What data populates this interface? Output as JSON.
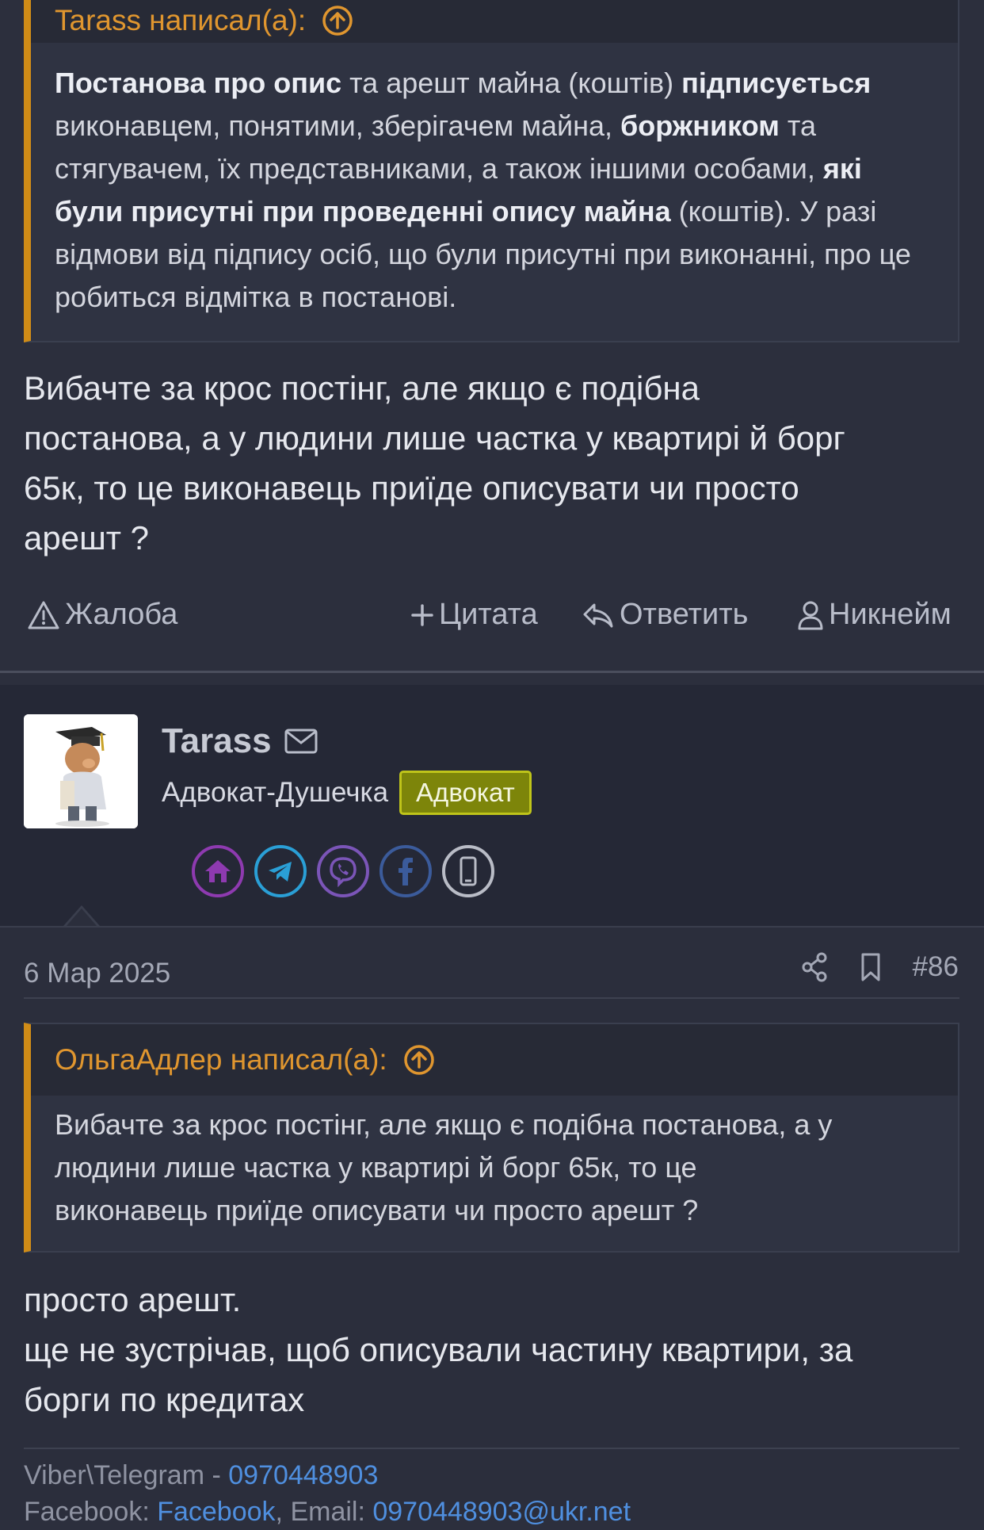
{
  "post1": {
    "quote": {
      "author_line": "Tarass написал(а):",
      "bold1": "Постанова про опис",
      "text1": " та арешт майна (коштів) ",
      "bold2": "підписується",
      "text2": " виконавцем, понятими, зберігачем майна, ",
      "bold3": "боржником",
      "text3": " та стягувачем, їх представниками, а також іншими особами, ",
      "bold4": "які були присутні при проведенні опису майна",
      "text4": " (коштів). У разі відмови від підпису осіб, що були присутні при виконанні, про це робиться відмітка в постанові."
    },
    "message_lines": [
      "Вибачте за крос постінг, але якщо є подібна",
      "постанова, а у людини лише частка у квартирі й борг",
      "65к, то це виконавець приїде описувати чи просто",
      "арешт ?"
    ],
    "actions": {
      "report": "Жалоба",
      "quote": "Цитата",
      "reply": "Ответить",
      "nickname": "Никнейм"
    }
  },
  "post2": {
    "user": {
      "name": "Tarass",
      "title": "Адвокат-Душечка",
      "badge": "Адвокат"
    },
    "socials": [
      {
        "icon": "home-icon",
        "color": "#8e3ab0"
      },
      {
        "icon": "telegram-icon",
        "color": "#2a9fd6"
      },
      {
        "icon": "viber-icon",
        "color": "#7b55b8"
      },
      {
        "icon": "facebook-icon",
        "color": "#3b5b9b"
      },
      {
        "icon": "phone-icon",
        "color": "#b9bcc6"
      }
    ],
    "date": "6 Мар 2025",
    "post_number": "#86",
    "quote": {
      "author_line": "ОльгаАдлер написал(а):",
      "lines": [
        "Вибачте за крос постінг, але якщо є подібна постанова, а у",
        "людини лише частка у квартирі й борг 65к, то це",
        "виконавець приїде описувати чи просто арешт ?"
      ]
    },
    "message_lines": [
      "просто арешт.",
      "ще не зустрічав, щоб описували частину квартири, за",
      "борги по кредитах"
    ],
    "signature": {
      "line1_label": "Viber\\Telegram - ",
      "line1_phone": "0970448903",
      "line2_label": "Facebook: ",
      "line2_fb": "Facebook",
      "line2_email_label": ", Email: ",
      "line2_email": "0970448903@ukr.net"
    }
  }
}
